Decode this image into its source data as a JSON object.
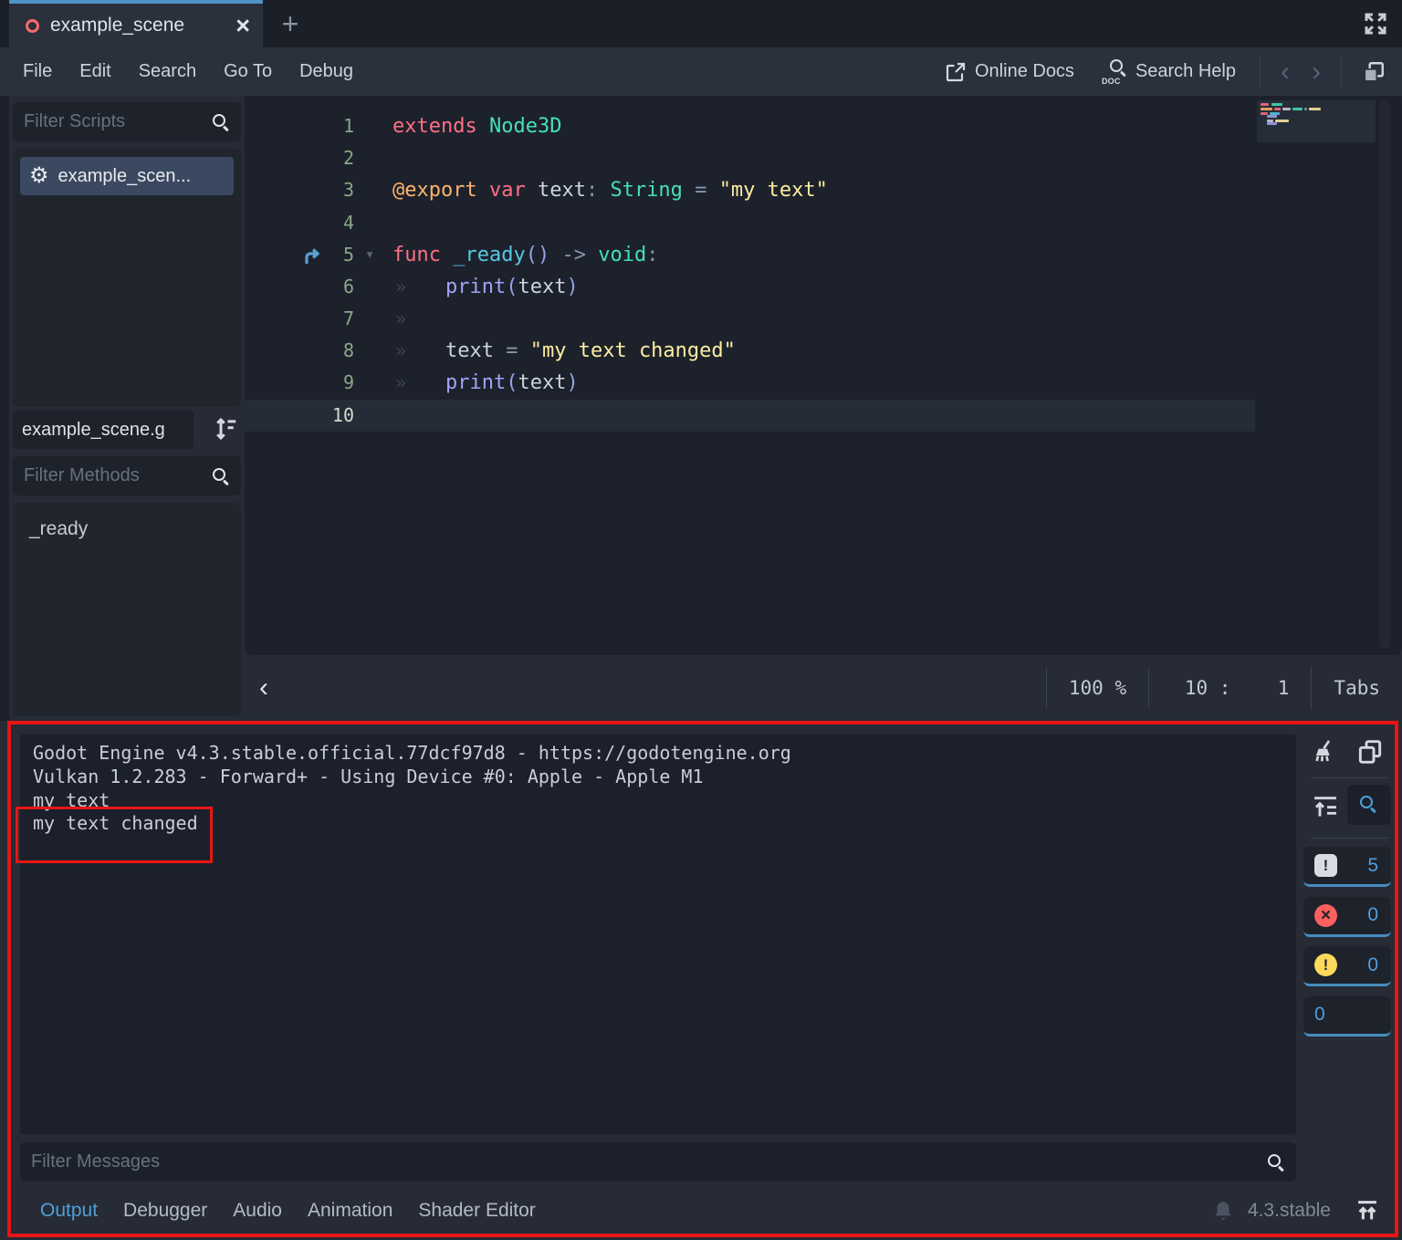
{
  "tab_bar": {
    "tabs": [
      {
        "label": "example_scene",
        "icon": "node3d-ring-icon",
        "close_glyph": "×",
        "active": true
      }
    ],
    "new_tab_glyph": "+"
  },
  "menu": {
    "items": [
      "File",
      "Edit",
      "Search",
      "Go To",
      "Debug"
    ],
    "online_docs": "Online Docs",
    "search_help": "Search Help",
    "search_help_icon_text": "DOC",
    "back_glyph": "‹",
    "forward_glyph": "›"
  },
  "sidebar": {
    "filter_scripts_placeholder": "Filter Scripts",
    "scripts": [
      {
        "label": "example_scen...",
        "selected": true
      }
    ],
    "script_path": "example_scene.g",
    "filter_methods_placeholder": "Filter Methods",
    "methods": [
      "_ready"
    ]
  },
  "editor": {
    "token_colors": {
      "kw": "#ff7085",
      "type": "#45e0b5",
      "ann": "#ffb26b",
      "str": "#ffeda1",
      "fn": "#57c7e3",
      "call": "#a3a3f5",
      "par": "#93a3e6",
      "id": "#ccd3df",
      "op": "#8897b0",
      "pl": "#ccd3df"
    },
    "tab_mark_glyph": "»",
    "fold_glyph": "▾",
    "lines": [
      {
        "num": "1",
        "indent": 0,
        "segs": [
          [
            "kw",
            "extends"
          ],
          [
            "pl",
            " "
          ],
          [
            "type",
            "Node3D"
          ]
        ]
      },
      {
        "num": "2",
        "indent": 0,
        "segs": []
      },
      {
        "num": "3",
        "indent": 0,
        "segs": [
          [
            "ann",
            "@export"
          ],
          [
            "pl",
            " "
          ],
          [
            "kw",
            "var"
          ],
          [
            "pl",
            " "
          ],
          [
            "id",
            "text"
          ],
          [
            "op",
            ":"
          ],
          [
            "pl",
            " "
          ],
          [
            "type",
            "String"
          ],
          [
            "pl",
            " "
          ],
          [
            "op",
            "="
          ],
          [
            "pl",
            " "
          ],
          [
            "str",
            "\"my text\""
          ]
        ]
      },
      {
        "num": "4",
        "indent": 0,
        "segs": []
      },
      {
        "num": "5",
        "indent": 0,
        "override": true,
        "fold": true,
        "segs": [
          [
            "kw",
            "func"
          ],
          [
            "pl",
            " "
          ],
          [
            "fn",
            "_ready"
          ],
          [
            "par",
            "()"
          ],
          [
            "pl",
            " "
          ],
          [
            "op",
            "->"
          ],
          [
            "pl",
            " "
          ],
          [
            "type",
            "void"
          ],
          [
            "op",
            ":"
          ]
        ]
      },
      {
        "num": "6",
        "indent": 1,
        "segs": [
          [
            "call",
            "print"
          ],
          [
            "par",
            "("
          ],
          [
            "id",
            "text"
          ],
          [
            "par",
            ")"
          ]
        ]
      },
      {
        "num": "7",
        "indent": 1,
        "segs": []
      },
      {
        "num": "8",
        "indent": 1,
        "segs": [
          [
            "id",
            "text"
          ],
          [
            "pl",
            " "
          ],
          [
            "op",
            "="
          ],
          [
            "pl",
            " "
          ],
          [
            "str",
            "\"my text changed\""
          ]
        ]
      },
      {
        "num": "9",
        "indent": 1,
        "segs": [
          [
            "call",
            "print"
          ],
          [
            "par",
            "("
          ],
          [
            "id",
            "text"
          ],
          [
            "par",
            ")"
          ]
        ]
      },
      {
        "num": "10",
        "indent": 0,
        "current": true,
        "segs": []
      }
    ],
    "status": {
      "back_glyph": "‹",
      "zoom": "100 %",
      "line": "10",
      "colon": ":",
      "col": "1",
      "indent_type": "Tabs"
    },
    "minimap_bars": [
      {
        "y": 3,
        "x": 4,
        "w": 9,
        "c": "#ff7085"
      },
      {
        "y": 3,
        "x": 16,
        "w": 12,
        "c": "#45e0b5"
      },
      {
        "y": 8,
        "x": 4,
        "w": 13,
        "c": "#ffb26b"
      },
      {
        "y": 8,
        "x": 19,
        "w": 7,
        "c": "#ff7085"
      },
      {
        "y": 8,
        "x": 28,
        "w": 9,
        "c": "#ccd3df"
      },
      {
        "y": 8,
        "x": 39,
        "w": 11,
        "c": "#45e0b5"
      },
      {
        "y": 8,
        "x": 52,
        "w": 3,
        "c": "#8897b0"
      },
      {
        "y": 8,
        "x": 57,
        "w": 13,
        "c": "#ffeda1"
      },
      {
        "y": 13,
        "x": 4,
        "w": 8,
        "c": "#ff7085"
      },
      {
        "y": 13,
        "x": 14,
        "w": 11,
        "c": "#57c7e3"
      },
      {
        "y": 16,
        "x": 11,
        "w": 11,
        "c": "#a3a3f5"
      },
      {
        "y": 21,
        "x": 11,
        "w": 7,
        "c": "#ccd3df"
      },
      {
        "y": 21,
        "x": 20,
        "w": 15,
        "c": "#ffeda1"
      },
      {
        "y": 24,
        "x": 11,
        "w": 11,
        "c": "#a3a3f5"
      }
    ]
  },
  "output": {
    "console_lines": [
      "Godot Engine v4.3.stable.official.77dcf97d8 - https://godotengine.org",
      "Vulkan 1.2.283 - Forward+ - Using Device #0: Apple - Apple M1",
      "",
      "my text",
      "my text changed"
    ],
    "counters": [
      {
        "name": "messages",
        "glyph": "!",
        "count": "5"
      },
      {
        "name": "errors",
        "glyph": "×",
        "count": "0"
      },
      {
        "name": "warnings",
        "glyph": "!",
        "count": "0"
      },
      {
        "name": "editor",
        "glyph": "",
        "count": "0"
      }
    ],
    "filter_placeholder": "Filter Messages",
    "tabs": [
      {
        "label": "Output",
        "active": true
      },
      {
        "label": "Debugger"
      },
      {
        "label": "Audio"
      },
      {
        "label": "Animation"
      },
      {
        "label": "Shader Editor"
      }
    ],
    "version": "4.3.stable"
  },
  "annotation": {
    "color": "#e81515"
  }
}
